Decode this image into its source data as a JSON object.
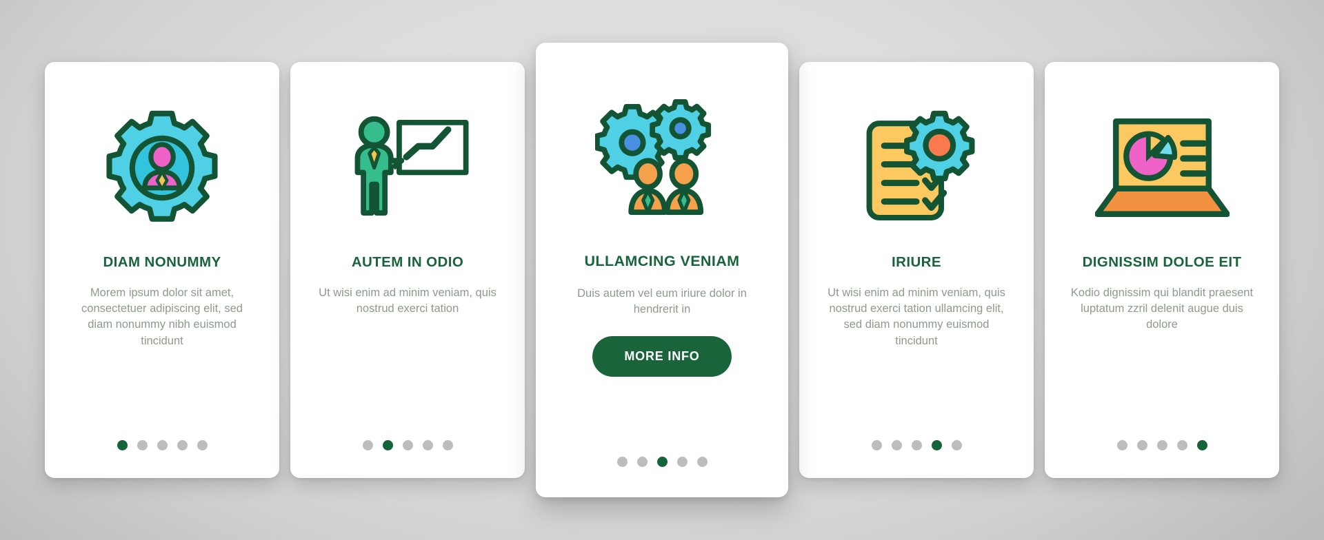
{
  "palette": {
    "dark_green": "#19643b",
    "body_text": "#8d9a8d",
    "dot_inactive": "#bdbdbd",
    "dot_active": "#14643a",
    "card_bg": "#ffffff",
    "page_bg": "#d8d8d8",
    "cyan": "#4fd0e4",
    "blue": "#4a90e2",
    "orange": "#f5a04a",
    "yellow": "#fbc95f",
    "pink": "#ef63c8",
    "teal": "#35bd8e",
    "stroke": "#125434"
  },
  "cards": [
    {
      "id": "card-diam-nonummy",
      "icon": "gear-person-icon",
      "title": "DIAM NONUMMY",
      "body": "Morem ipsum dolor sit amet, consectetuer adipiscing elit, sed diam nonummy nibh euismod tincidunt",
      "featured": false,
      "dots": {
        "count": 5,
        "active_index": 0
      }
    },
    {
      "id": "card-autem-in-odio",
      "icon": "presenter-whiteboard-icon",
      "title": "AUTEM IN ODIO",
      "body": "Ut wisi enim ad minim veniam, quis nostrud exerci tation",
      "featured": false,
      "dots": {
        "count": 5,
        "active_index": 1
      }
    },
    {
      "id": "card-ullamcing-veniam",
      "icon": "gears-team-icon",
      "title": "ULLAMCING VENIAM",
      "body": "Duis autem vel eum iriure dolor in hendrerit in",
      "featured": true,
      "button_label": "MORE INFO",
      "dots": {
        "count": 5,
        "active_index": 2
      }
    },
    {
      "id": "card-iriure",
      "icon": "checklist-gear-icon",
      "title": "IRIURE",
      "body": "Ut wisi enim ad minim veniam, quis nostrud exerci tation ullamcing elit, sed diam nonummy euismod tincidunt",
      "featured": false,
      "dots": {
        "count": 5,
        "active_index": 3
      }
    },
    {
      "id": "card-dignissim-doloe-eit",
      "icon": "laptop-pie-chart-icon",
      "title": "DIGNISSIM DOLOE EIT",
      "body": "Kodio dignissim qui blandit praesent luptatum zzril delenit augue duis dolore",
      "featured": false,
      "dots": {
        "count": 5,
        "active_index": 4
      }
    }
  ]
}
